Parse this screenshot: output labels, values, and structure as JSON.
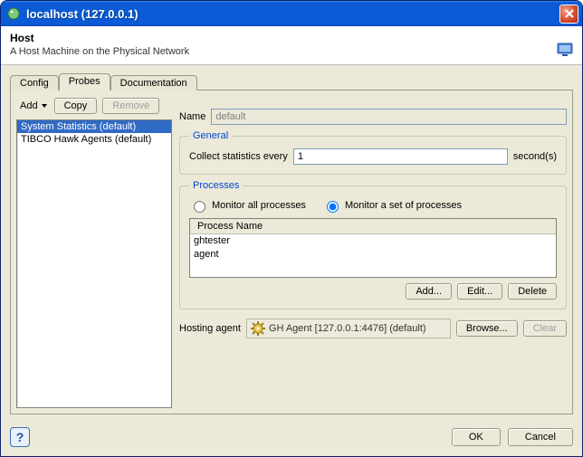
{
  "window": {
    "title": "localhost (127.0.0.1)"
  },
  "header": {
    "title": "Host",
    "description": "A Host Machine on the Physical Network"
  },
  "tabs": {
    "config": "Config",
    "probes": "Probes",
    "documentation": "Documentation"
  },
  "toolbar": {
    "add": "Add",
    "copy": "Copy",
    "remove": "Remove"
  },
  "probe_list": {
    "items": [
      "System Statistics (default)",
      "TIBCO Hawk Agents (default)"
    ]
  },
  "form": {
    "name_label": "Name",
    "name_value": "default"
  },
  "general": {
    "legend": "General",
    "collect_label": "Collect statistics every",
    "interval_value": "1",
    "seconds_label": "second(s)"
  },
  "processes": {
    "legend": "Processes",
    "monitor_all": "Monitor all processes",
    "monitor_set": "Monitor a set of processes",
    "col_process_name": "Process Name",
    "rows": [
      "ghtester",
      "agent"
    ],
    "add": "Add...",
    "edit": "Edit...",
    "delete": "Delete"
  },
  "hosting": {
    "label": "Hosting agent",
    "agent_text": "GH Agent [127.0.0.1:4476] (default)",
    "browse": "Browse...",
    "clear": "Clear"
  },
  "footer": {
    "ok": "OK",
    "cancel": "Cancel"
  }
}
